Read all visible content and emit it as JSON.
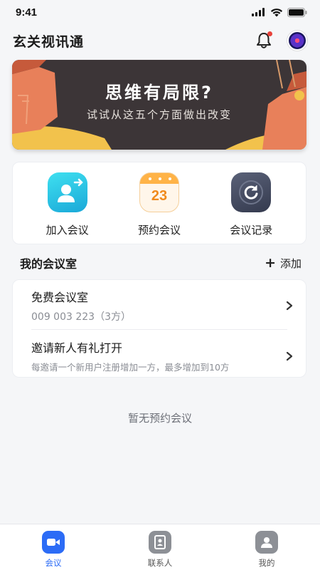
{
  "status": {
    "time": "9:41"
  },
  "header": {
    "title": "玄关视讯通"
  },
  "banner": {
    "title": "思维有局限?",
    "subtitle": "试试从这五个方面做出改变"
  },
  "actions": [
    {
      "label": "加入会议",
      "icon": "join-meeting-icon"
    },
    {
      "label": "预约会议",
      "icon": "calendar-icon",
      "day": "23"
    },
    {
      "label": "会议记录",
      "icon": "history-icon"
    }
  ],
  "my_rooms": {
    "title": "我的会议室",
    "add_label": "添加",
    "rows": [
      {
        "title": "免费会议室",
        "subtitle": "009 003 223（3方）"
      },
      {
        "title": "邀请新人有礼打开",
        "subtitle": "每邀请一个新用户注册增加一方，最多增加到10方"
      }
    ]
  },
  "empty_state": "暂无预约会议",
  "tabs": [
    {
      "label": "会议",
      "active": true
    },
    {
      "label": "联系人",
      "active": false
    },
    {
      "label": "我的",
      "active": false
    }
  ],
  "colors": {
    "accent": "#2c6cf6",
    "notification_dot": "#e8423b",
    "banner_bg": "#3c3537"
  }
}
